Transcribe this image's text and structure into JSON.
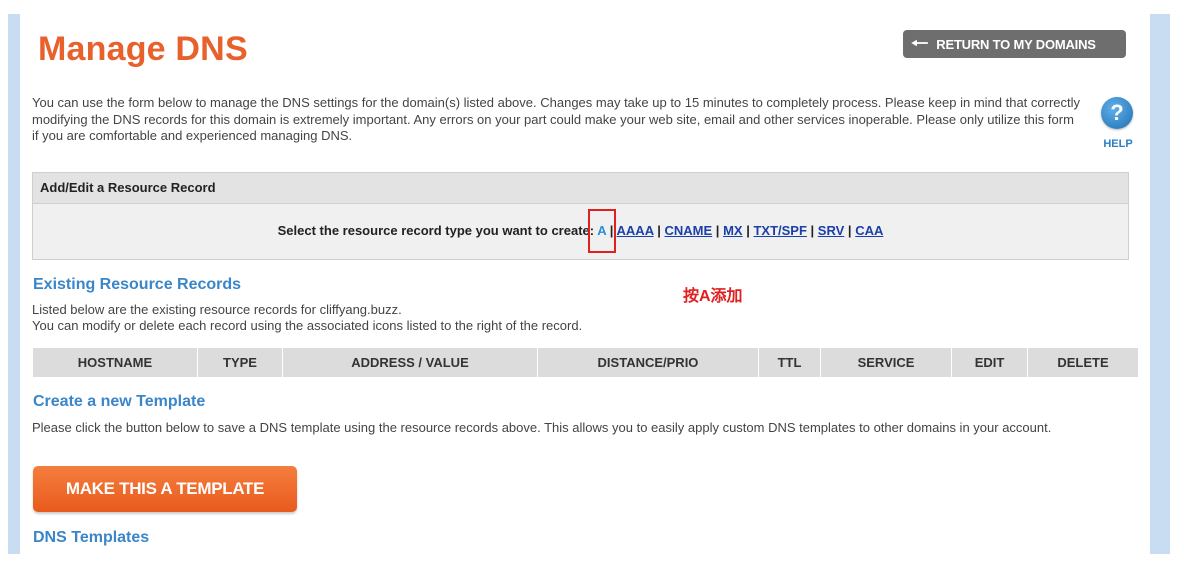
{
  "page": {
    "title": "Manage DNS",
    "return_button": "RETURN TO MY DOMAINS",
    "intro": "You can use the form below to manage the DNS settings for the domain(s) listed above. Changes may take up to 15 minutes to completely process. Please keep in mind that correctly modifying the DNS records for this domain is extremely important. Any errors on your part could make your web site, email and other services inoperable. Please only utilize this form if you are comfortable and experienced managing DNS.",
    "help_label": "HELP",
    "help_symbol": "?"
  },
  "add_panel": {
    "header": "Add/Edit a Resource Record",
    "prompt": "Select the resource record type you want to create:",
    "types": [
      "A",
      "AAAA",
      "CNAME",
      "MX",
      "TXT/SPF",
      "SRV",
      "CAA"
    ]
  },
  "annotation": "按A添加",
  "existing": {
    "title": "Existing Resource Records",
    "desc_line1": "Listed below are the existing resource records for cliffyang.buzz.",
    "desc_line2": "You can modify or delete each record using the associated icons listed to the right of the record.",
    "columns": [
      "HOSTNAME",
      "TYPE",
      "ADDRESS / VALUE",
      "DISTANCE/PRIO",
      "TTL",
      "SERVICE",
      "EDIT",
      "DELETE"
    ]
  },
  "template": {
    "title": "Create a new Template",
    "desc": "Please click the button below to save a DNS template using the resource records above. This allows you to easily apply custom DNS templates to other domains in your account.",
    "button": "MAKE THIS A TEMPLATE"
  },
  "dns_templates": {
    "title": "DNS Templates"
  },
  "icons": {
    "return": "arrow-left-icon",
    "help": "help-icon"
  },
  "colors": {
    "title": "#e8612c",
    "section": "#3a86c8",
    "link": "#1a3fa8",
    "annotation": "#e02020",
    "template_button": "#e85a1c"
  }
}
